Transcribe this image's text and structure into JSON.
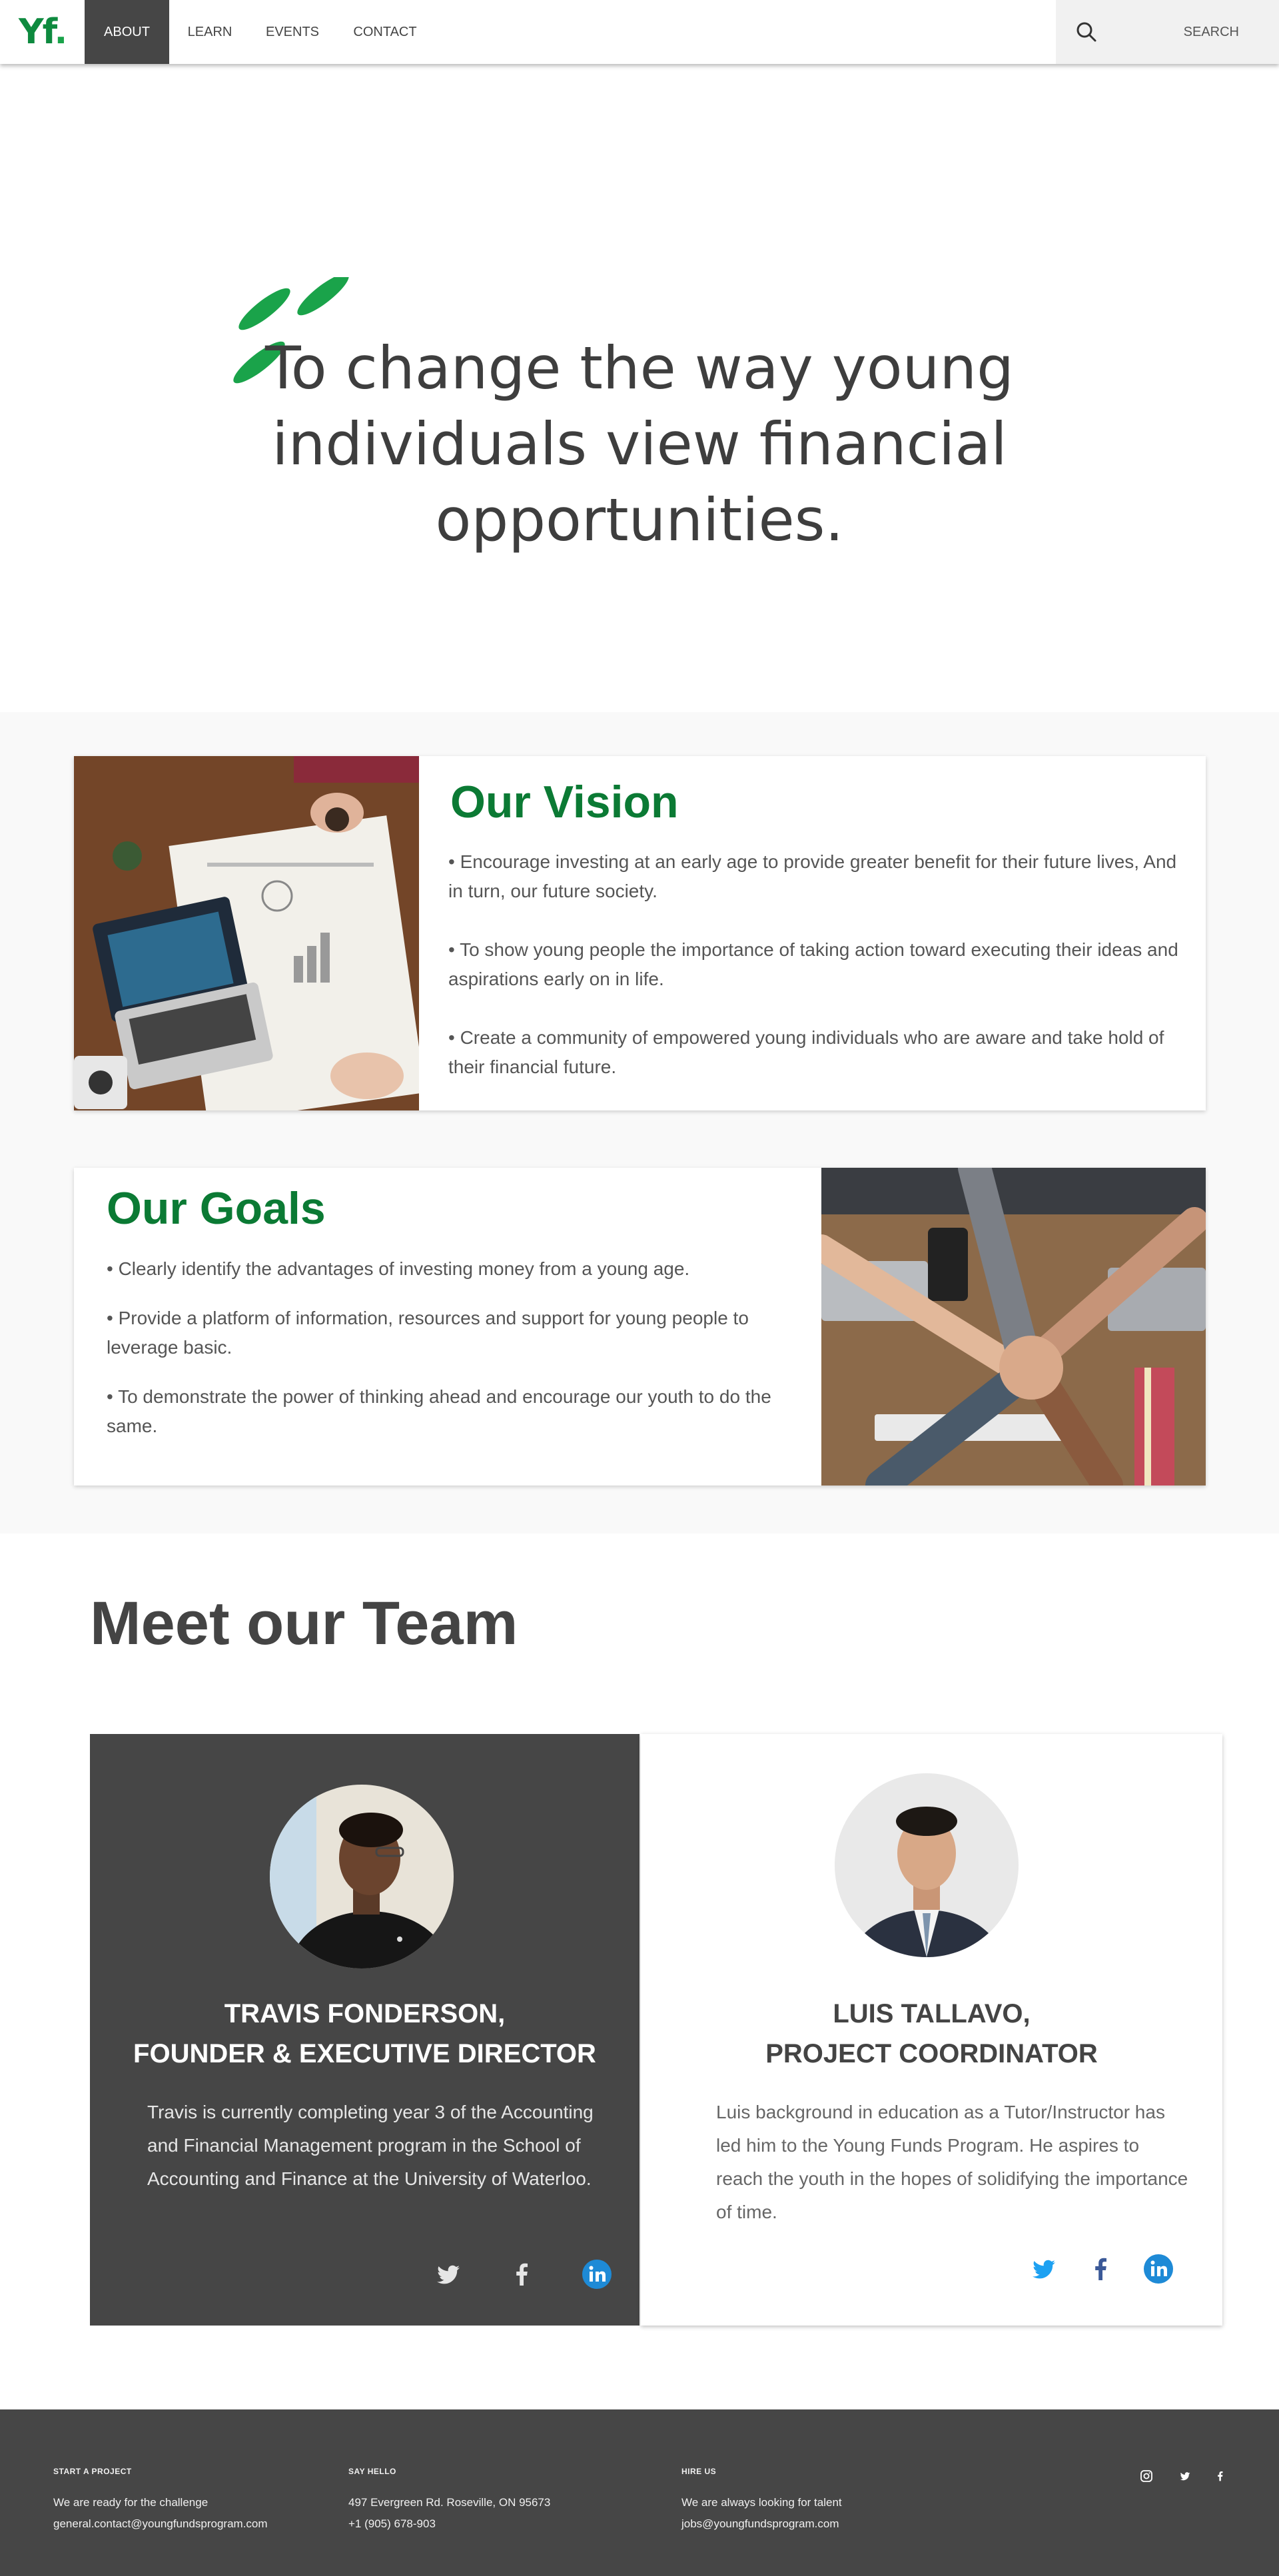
{
  "nav": {
    "logo": "Yf",
    "logo_dot": ".",
    "items": [
      {
        "label": "About",
        "active": true
      },
      {
        "label": "Learn",
        "active": false
      },
      {
        "label": "Events",
        "active": false
      },
      {
        "label": "Contact",
        "active": false
      }
    ],
    "search_label": "SEARCH",
    "search_icon": "search-icon"
  },
  "hero": {
    "quote_line1": "To change the way young",
    "quote_line2": "individuals view financial",
    "quote_line3": "opportunities.",
    "quote_icon": "quote-mark-icon",
    "accent_color": "#1aa34a"
  },
  "vision": {
    "title": "Our Vision",
    "points": [
      "• Encourage investing at an early age to provide greater benefit for their future lives, And in turn, our future society.",
      "• To show young people the importance of taking action toward executing their ideas and aspirations early on in life.",
      "• Create a community of empowered young individuals who are aware and take hold of their financial future."
    ]
  },
  "goals": {
    "title": "Our Goals",
    "points": [
      "• Clearly identify the advantages of investing money from a young age.",
      "• Provide a platform of information, resources and support for young people to leverage basic.",
      "• To demonstrate the power of thinking ahead and encourage our youth to do the same."
    ]
  },
  "team": {
    "title": "Meet our Team",
    "members": [
      {
        "name_line1": "Travis Fonderson,",
        "name_line2": "Founder & Executive Director",
        "bio": "Travis is currently completing year 3 of the Accounting and Financial Management program in the School of Accounting and Finance at the University of Waterloo."
      },
      {
        "name_line1": "Luis Tallavo,",
        "name_line2": "Project Coordinator",
        "bio": "Luis background in education as a Tutor/Instructor has led him to the Young Funds Program. He aspires to reach the youth in the hopes of solidifying the importance of time."
      }
    ],
    "social_icons": [
      "twitter-icon",
      "facebook-icon",
      "linkedin-icon"
    ]
  },
  "footer": {
    "col1": {
      "heading": "Start a project",
      "line1": "We are ready for the challenge",
      "line2": "general.contact@youngfundsprogram.com"
    },
    "col2": {
      "heading": "Say hello",
      "line1": "497 Evergreen Rd. Roseville, ON 95673",
      "line2": "+1 (905) 678-903"
    },
    "col3": {
      "heading": "Hire us",
      "line1": "We are always looking for talent",
      "line2": "jobs@youngfundsprogram.com"
    },
    "icons": [
      "instagram-icon",
      "twitter-icon",
      "facebook-icon"
    ]
  },
  "colors": {
    "brand_green": "#0b7a34",
    "dark_grey": "#464646",
    "twitter_blue": "#1da1f2",
    "facebook_blue": "#3b5998",
    "linkedin_blue": "#1e8ad6"
  }
}
